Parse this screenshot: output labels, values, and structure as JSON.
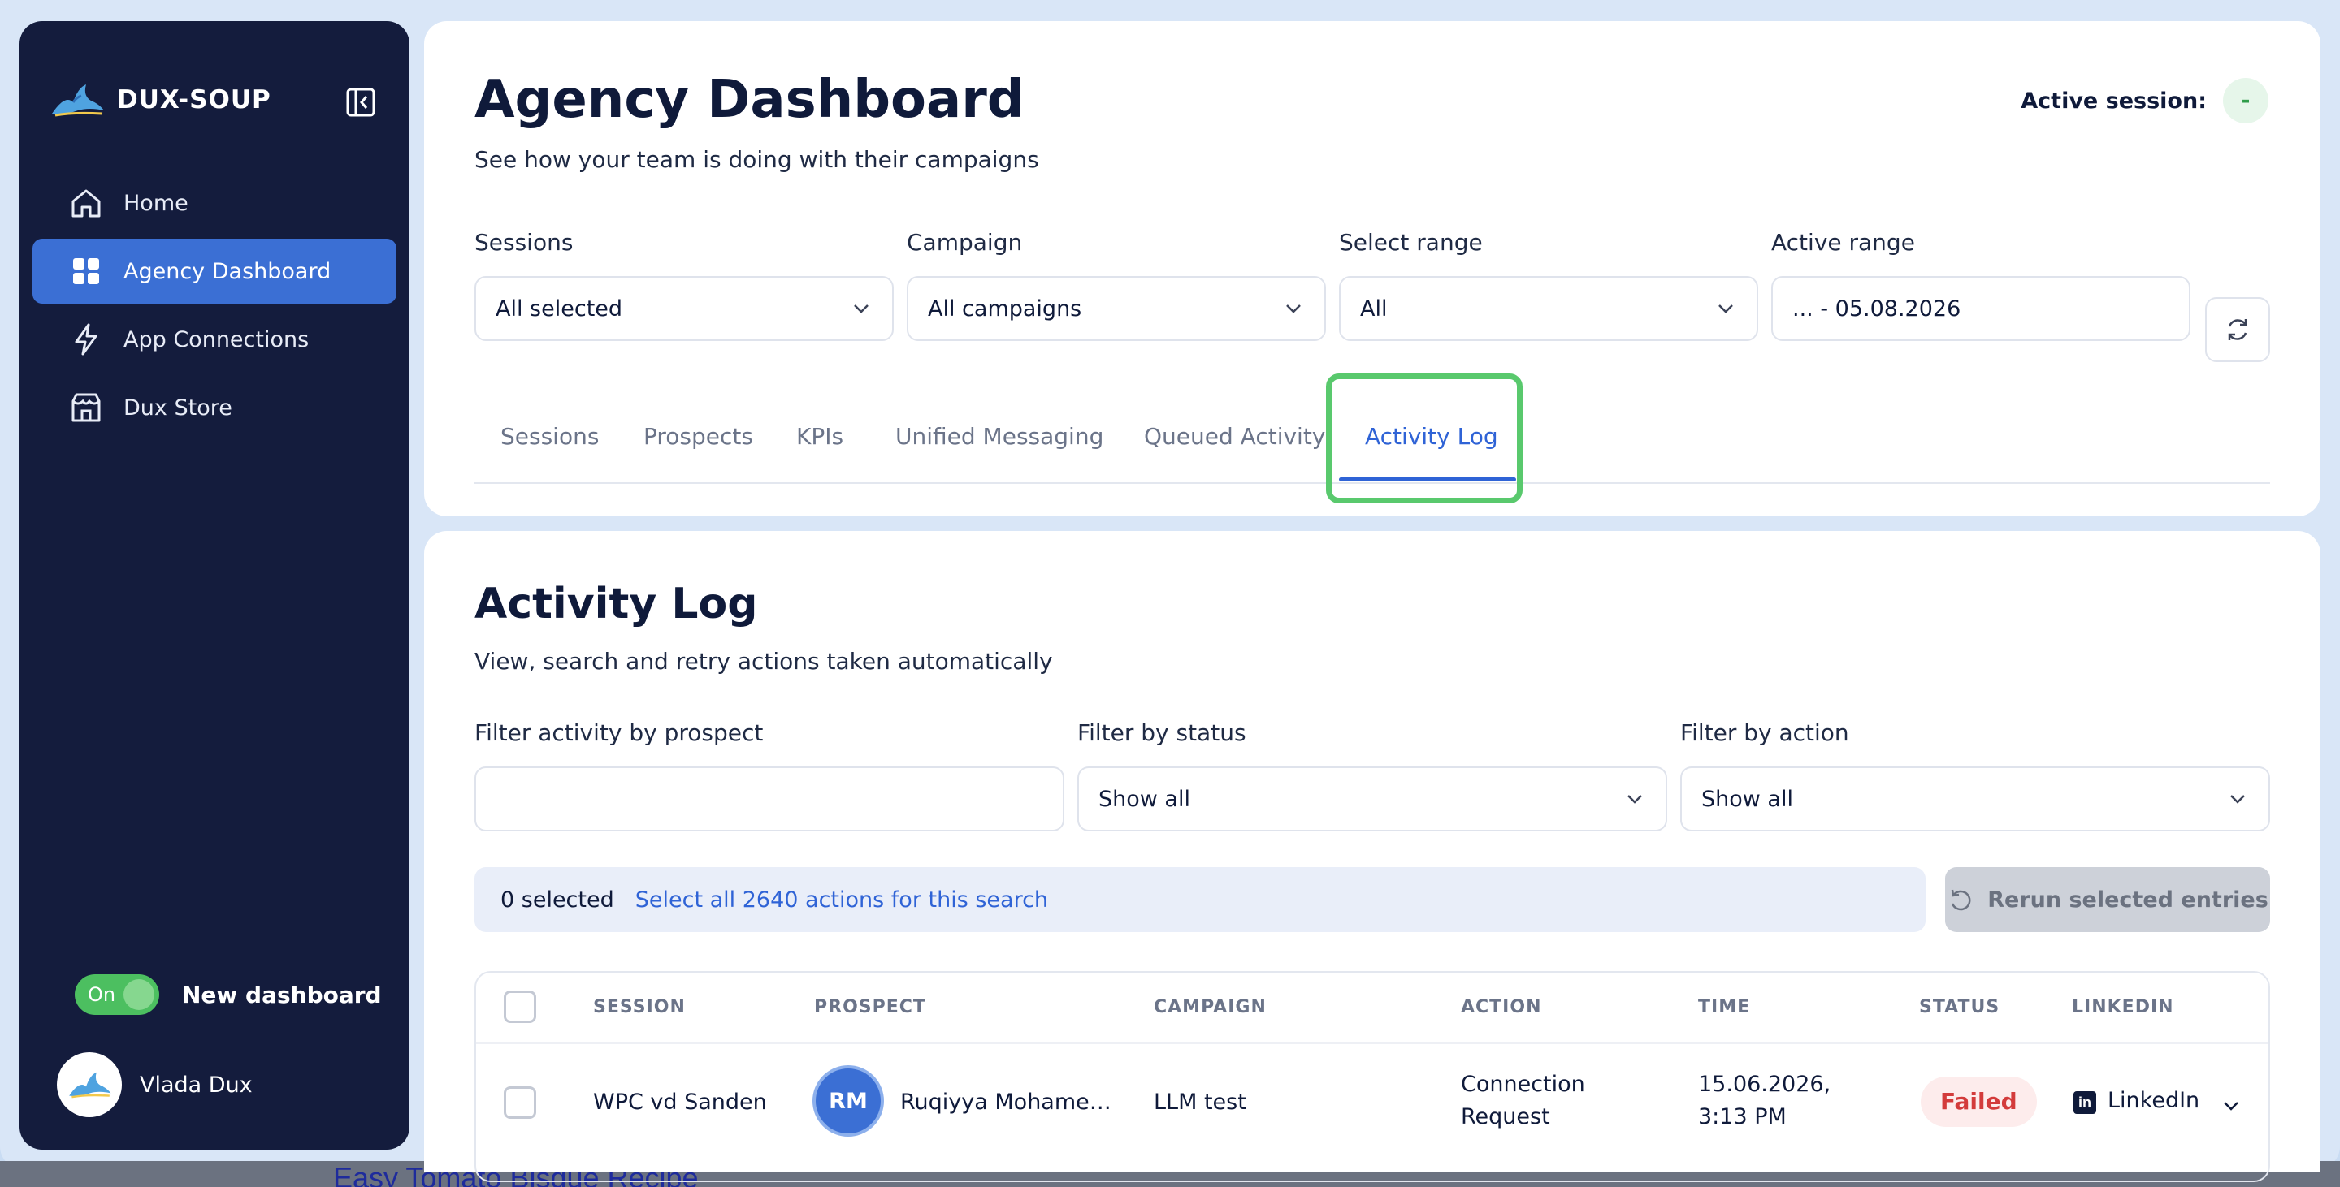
{
  "brand": {
    "name": "DUX-SOUP"
  },
  "sidebar": {
    "items": [
      {
        "label": "Home",
        "icon": "home-icon"
      },
      {
        "label": "Agency Dashboard",
        "icon": "grid-icon",
        "active": true
      },
      {
        "label": "App Connections",
        "icon": "lightning-icon"
      },
      {
        "label": "Dux Store",
        "icon": "store-icon"
      }
    ],
    "toggle": {
      "state": "On",
      "label": "New dashboard"
    },
    "user": {
      "name": "Vlada Dux"
    }
  },
  "header": {
    "title": "Agency Dashboard",
    "subtitle": "See how your team is doing with their campaigns",
    "active_session_label": "Active session:",
    "active_session_value": "-"
  },
  "filters": {
    "sessions": {
      "label": "Sessions",
      "value": "All selected"
    },
    "campaign": {
      "label": "Campaign",
      "value": "All campaigns"
    },
    "range": {
      "label": "Select range",
      "value": "All"
    },
    "active_range": {
      "label": "Active range",
      "value": "... - 05.08.2026"
    }
  },
  "tabs": [
    {
      "label": "Sessions"
    },
    {
      "label": "Prospects"
    },
    {
      "label": "KPIs"
    },
    {
      "label": "Unified Messaging"
    },
    {
      "label": "Queued Activity"
    },
    {
      "label": "Activity Log",
      "active": true
    }
  ],
  "activity_log": {
    "title": "Activity Log",
    "subtitle": "View, search and retry actions taken automatically",
    "filter_prospect": {
      "label": "Filter activity by prospect",
      "value": ""
    },
    "filter_status": {
      "label": "Filter by status",
      "value": "Show all"
    },
    "filter_action": {
      "label": "Filter by action",
      "value": "Show all"
    },
    "selection": {
      "count": "0 selected",
      "select_all_link": "Select all 2640 actions for this search"
    },
    "rerun_label": "Rerun selected entries",
    "columns": [
      "SESSION",
      "PROSPECT",
      "CAMPAIGN",
      "ACTION",
      "TIME",
      "STATUS",
      "LINKEDIN"
    ],
    "rows": [
      {
        "session": "WPC vd Sanden",
        "initials": "RM",
        "prospect": "Ruqiyya Mohame…",
        "campaign": "LLM test",
        "action_line1": "Connection",
        "action_line2": "Request",
        "time_line1": "15.06.2026,",
        "time_line2": "3:13 PM",
        "status": "Failed",
        "linkedin": "LinkedIn"
      }
    ]
  },
  "background": {
    "link_text": "Easy Tomato Bisque Recipe"
  },
  "colors": {
    "sidebar_bg": "#141c3d",
    "accent": "#2f63d6",
    "active_nav": "#3b6fd4",
    "toggle_on": "#4cbf60",
    "failed": "#d33b3b",
    "highlight": "#59c96d"
  }
}
